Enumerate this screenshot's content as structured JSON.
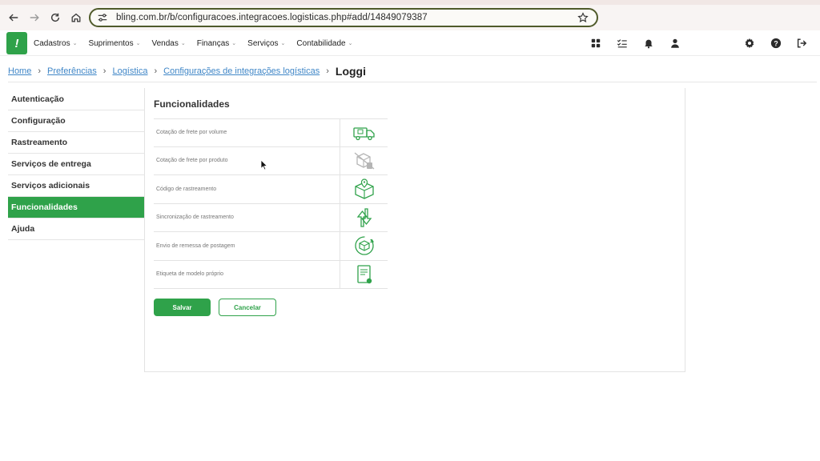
{
  "browser": {
    "url": "bling.com.br/b/configuracoes.integracoes.logisticas.php#add/14849079387"
  },
  "nav": {
    "logo_text": "!",
    "menu": [
      {
        "label": "Cadastros"
      },
      {
        "label": "Suprimentos"
      },
      {
        "label": "Vendas"
      },
      {
        "label": "Finanças"
      },
      {
        "label": "Serviços"
      },
      {
        "label": "Contabilidade"
      }
    ],
    "icons": [
      "apps-icon",
      "tasks-icon",
      "bell-icon",
      "user-icon",
      "gear-icon",
      "help-icon",
      "logout-icon"
    ]
  },
  "breadcrumb": {
    "items": [
      "Home",
      "Preferências",
      "Logística",
      "Configurações de integrações logísticas"
    ],
    "current": "Loggi"
  },
  "sidebar": {
    "items": [
      {
        "label": "Autenticação"
      },
      {
        "label": "Configuração"
      },
      {
        "label": "Rastreamento"
      },
      {
        "label": "Serviços de entrega"
      },
      {
        "label": "Serviços adicionais"
      },
      {
        "label": "Funcionalidades",
        "active": true
      },
      {
        "label": "Ajuda"
      }
    ]
  },
  "main": {
    "title": "Funcionalidades",
    "features": [
      {
        "label": "Cotação de frete por volume",
        "icon": "truck-icon"
      },
      {
        "label": "Cotação de frete por produto",
        "icon": "box-disabled-icon"
      },
      {
        "label": "Código de rastreamento",
        "icon": "box-location-icon"
      },
      {
        "label": "Sincronização de rastreamento",
        "icon": "sync-arrows-icon"
      },
      {
        "label": "Envio de remessa de postagem",
        "icon": "box-send-icon"
      },
      {
        "label": "Etiqueta de modelo próprio",
        "icon": "label-document-icon"
      }
    ],
    "save_label": "Salvar",
    "cancel_label": "Cancelar"
  },
  "colors": {
    "brand_green": "#2fa24a",
    "link_blue": "#3f86c7",
    "url_border": "#4f5a2a"
  }
}
